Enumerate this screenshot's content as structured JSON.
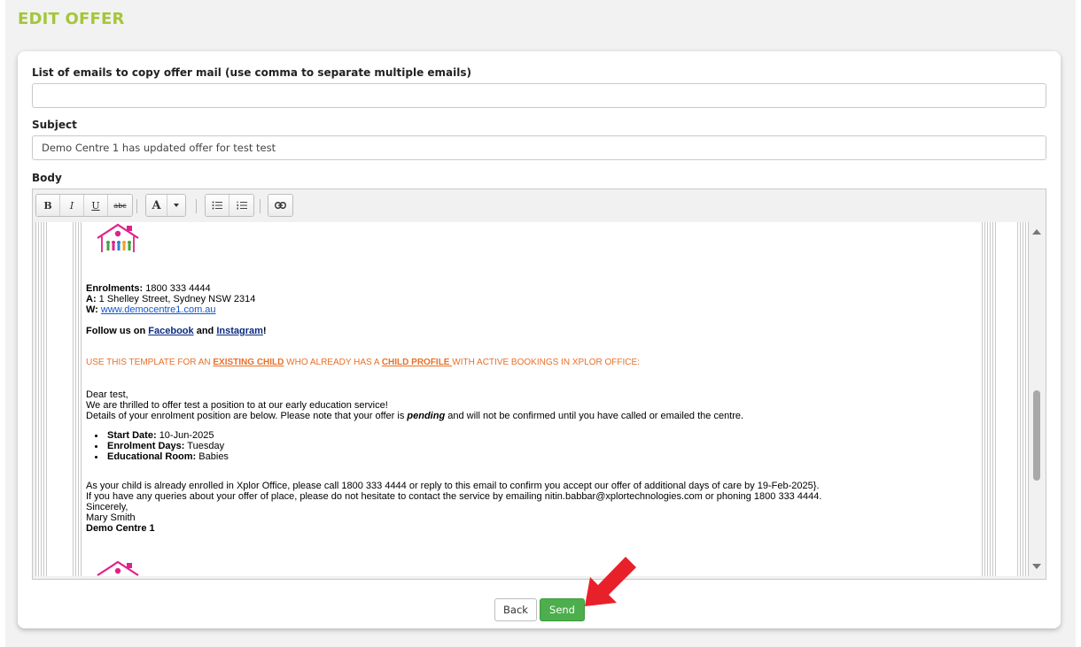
{
  "page": {
    "title": "EDIT OFFER"
  },
  "form": {
    "cc_label": "List of emails to copy offer mail (use comma to separate multiple emails)",
    "cc_value": "",
    "subject_label": "Subject",
    "subject_value": "Demo Centre 1 has updated offer for test test",
    "body_label": "Body"
  },
  "toolbar": {
    "bold": "B",
    "italic": "I",
    "underline": "U",
    "strike": "abc",
    "font_color": "A"
  },
  "email": {
    "enrol_label": "Enrolments:",
    "enrol_value": "1800 333 4444",
    "addr_label": "A:",
    "addr_value": "1 Shelley Street, Sydney NSW 2314",
    "web_label": "W:",
    "web_value": "www.democentre1.com.au",
    "follow_prefix": "Follow us on",
    "facebook": "Facebook",
    "and": "and",
    "instagram": "Instagram",
    "excl": "!",
    "tpl_1": "USE THIS TEMPLATE FOR AN ",
    "tpl_existing": "EXISTING CHILD",
    "tpl_2": " WHO ALREADY HAS A ",
    "tpl_profile": "CHILD PROFILE ",
    "tpl_3": "WITH ACTIVE BOOKINGS IN XPLOR OFFICE:",
    "greeting": "Dear test,",
    "line1": "We are thrilled to offer test a position to  at our early education service!",
    "line2_a": "Details of your enrolment position are below. Please note that your offer is ",
    "line2_pending": "pending",
    "line2_b": " and will not be confirmed until you have called or emailed the centre.",
    "start_label": "Start Date:",
    "start_value": "10-Jun-2025",
    "days_label": "Enrolment Days:",
    "days_value": "Tuesday",
    "room_label": "Educational Room:",
    "room_value": "Babies",
    "para1": "As your child is already enrolled in Xplor Office, please call 1800 333 4444 or reply to this email to confirm you accept our offer of additional days of care by 19-Feb-2025}.",
    "para2": "If you have any queries about your offer of place, please do not hesitate to contact the service by emailing nitin.babbar@xplortechnologies.com or phoning 1800 333 4444.",
    "sincerely": "Sincerely,",
    "signer": "Mary Smith",
    "centre": "Demo Centre 1"
  },
  "buttons": {
    "back": "Back",
    "send": "Send"
  },
  "colors": {
    "title": "#a4c639",
    "send": "#4cae4c",
    "arrow": "#e8202a",
    "template_note": "#e8702a",
    "logo": "#e0218a"
  }
}
